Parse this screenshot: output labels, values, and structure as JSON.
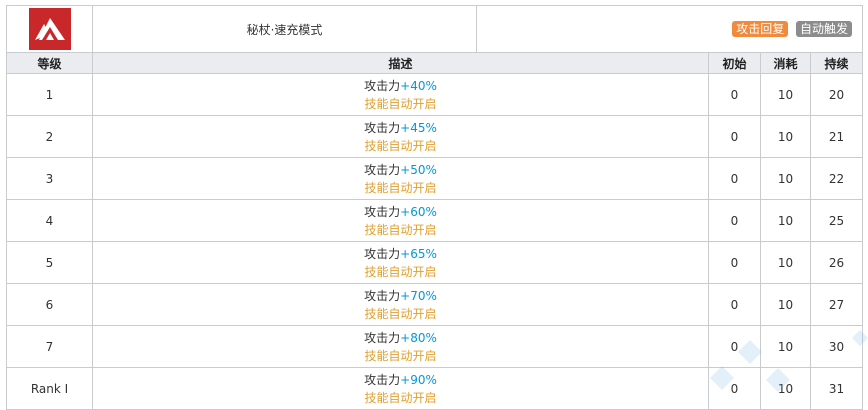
{
  "skill": {
    "name": "秘杖·速充模式",
    "tags": [
      {
        "label": "攻击回复",
        "color": "#f08a3c"
      },
      {
        "label": "自动触发",
        "color": "#8c8c8c"
      }
    ],
    "icon": "triangle-peaks-icon",
    "icon_color": "#c8282a"
  },
  "headers": {
    "level": "等级",
    "description": "描述",
    "initial": "初始",
    "cost": "消耗",
    "duration": "持续"
  },
  "rows": [
    {
      "level": "1",
      "desc_prefix": "攻击力",
      "desc_bonus": "+40%",
      "desc_auto": "技能自动开启",
      "initial": "0",
      "cost": "10",
      "duration": "20"
    },
    {
      "level": "2",
      "desc_prefix": "攻击力",
      "desc_bonus": "+45%",
      "desc_auto": "技能自动开启",
      "initial": "0",
      "cost": "10",
      "duration": "21"
    },
    {
      "level": "3",
      "desc_prefix": "攻击力",
      "desc_bonus": "+50%",
      "desc_auto": "技能自动开启",
      "initial": "0",
      "cost": "10",
      "duration": "22"
    },
    {
      "level": "4",
      "desc_prefix": "攻击力",
      "desc_bonus": "+60%",
      "desc_auto": "技能自动开启",
      "initial": "0",
      "cost": "10",
      "duration": "25"
    },
    {
      "level": "5",
      "desc_prefix": "攻击力",
      "desc_bonus": "+65%",
      "desc_auto": "技能自动开启",
      "initial": "0",
      "cost": "10",
      "duration": "26"
    },
    {
      "level": "6",
      "desc_prefix": "攻击力",
      "desc_bonus": "+70%",
      "desc_auto": "技能自动开启",
      "initial": "0",
      "cost": "10",
      "duration": "27"
    },
    {
      "level": "7",
      "desc_prefix": "攻击力",
      "desc_bonus": "+80%",
      "desc_auto": "技能自动开启",
      "initial": "0",
      "cost": "10",
      "duration": "30"
    },
    {
      "level": "Rank Ⅰ",
      "desc_prefix": "攻击力",
      "desc_bonus": "+90%",
      "desc_auto": "技能自动开启",
      "initial": "0",
      "cost": "10",
      "duration": "31"
    }
  ]
}
